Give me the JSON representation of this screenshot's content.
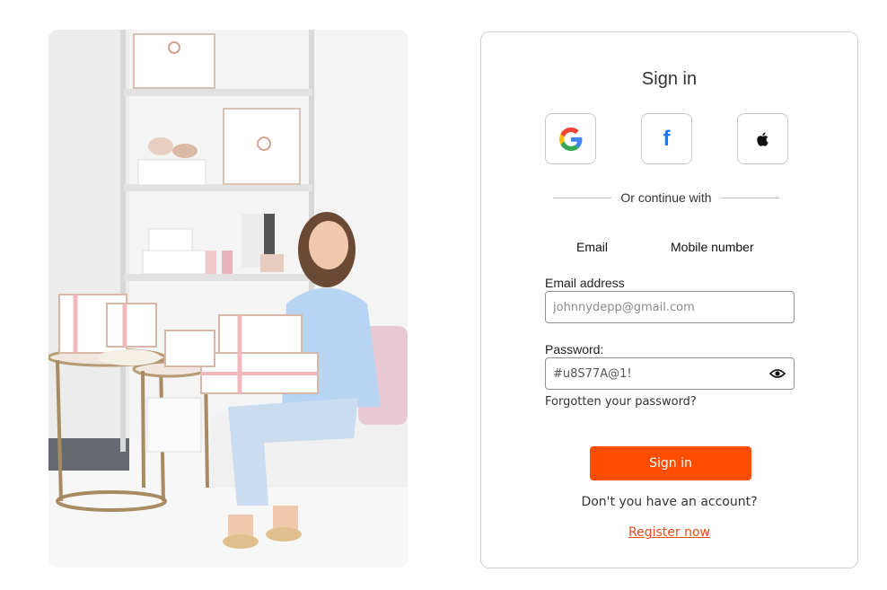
{
  "auth": {
    "title": "Sign in",
    "social": [
      {
        "name": "google",
        "icon": "google-icon",
        "glyph": ""
      },
      {
        "name": "facebook",
        "icon": "facebook-icon",
        "glyph": "f"
      },
      {
        "name": "apple",
        "icon": "apple-icon",
        "glyph": ""
      }
    ],
    "divider_text": "Or continue with",
    "tabs": [
      {
        "label": "Email"
      },
      {
        "label": "Mobile number"
      }
    ],
    "email": {
      "label": "Email address",
      "value": "",
      "placeholder": "johnnydepp@gmail.com"
    },
    "password": {
      "label": "Password:",
      "value": "#u8S77A@1!",
      "placeholder": ""
    },
    "forgot_link": "Forgotten your password?",
    "signin_button": "Sign in",
    "no_account_text": "Don't you have an account?",
    "register_link": "Register now"
  },
  "colors": {
    "accent": "#ff4d00",
    "link": "#e34e1c",
    "facebook": "#1877f2",
    "border": "#cfcfcf"
  }
}
